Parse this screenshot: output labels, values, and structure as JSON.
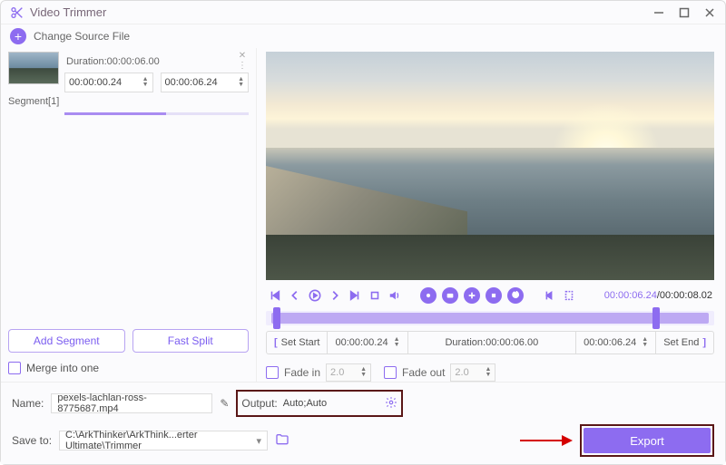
{
  "title": "Video Trimmer",
  "toolbar": {
    "change_source": "Change Source File"
  },
  "segment": {
    "label": "Segment[1]",
    "duration_label": "Duration:00:00:06.00",
    "start": "00:00:00.24",
    "end": "00:00:06.24"
  },
  "buttons": {
    "add_segment": "Add Segment",
    "fast_split": "Fast Split",
    "export": "Export"
  },
  "merge": {
    "label": "Merge into one"
  },
  "player": {
    "current": "00:00:06.24",
    "total": "/00:00:08.02"
  },
  "range": {
    "set_start": "Set Start",
    "start": "00:00:00.24",
    "duration_label": "Duration:00:00:06.00",
    "end": "00:00:06.24",
    "set_end": "Set End"
  },
  "fade": {
    "in_label": "Fade in",
    "in_value": "2.0",
    "out_label": "Fade out",
    "out_value": "2.0"
  },
  "footer": {
    "name_label": "Name:",
    "name_value": "pexels-lachlan-ross-8775687.mp4",
    "output_label": "Output:",
    "output_value": "Auto;Auto",
    "save_label": "Save to:",
    "save_value": "C:\\ArkThinker\\ArkThink...erter Ultimate\\Trimmer"
  }
}
